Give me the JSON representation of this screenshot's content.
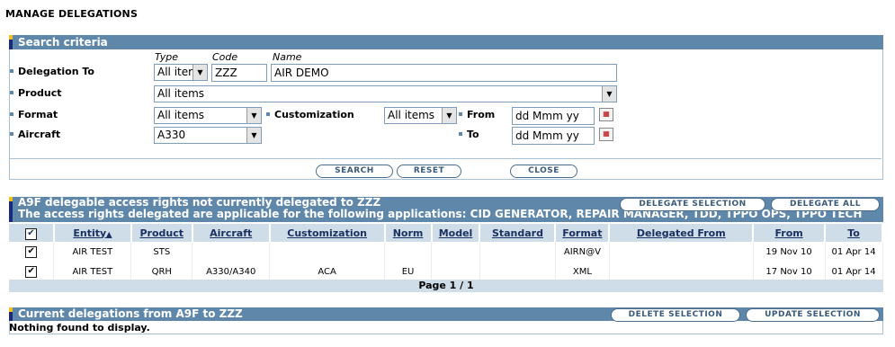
{
  "page_title": "MANAGE DELEGATIONS",
  "search": {
    "header": "Search criteria",
    "col_type": "Type",
    "col_code": "Code",
    "col_name": "Name",
    "delegation_to_label": "Delegation To",
    "delegation_type_value": "All iter",
    "delegation_code_value": "ZZZ",
    "delegation_name_value": "AIR DEMO",
    "product_label": "Product",
    "product_value": "All items",
    "format_label": "Format",
    "format_value": "All items",
    "customization_label": "Customization",
    "customization_value": "All items",
    "from_label": "From",
    "from_placeholder": "dd Mmm yy",
    "to_label": "To",
    "to_placeholder": "dd Mmm yy",
    "aircraft_label": "Aircraft",
    "aircraft_value": "A330",
    "search_button": "SEARCH",
    "reset_button": "RESET",
    "close_button": "CLOSE"
  },
  "rights": {
    "header_line1": "A9F delegable access rights not currently delegated to ZZZ",
    "header_line2": "The access rights delegated are applicable for the following applications: CID GENERATOR, REPAIR MANAGER, TDD, TPPO OPS, TPPO TECH",
    "delegate_selection_button": "DELEGATE SELECTION",
    "delegate_all_button": "DELEGATE ALL",
    "columns": [
      "Entity",
      "Product",
      "Aircraft",
      "Customization",
      "Norm",
      "Model",
      "Standard",
      "Format",
      "Delegated From",
      "From",
      "To"
    ],
    "sort_indicator": "▲",
    "rows": [
      {
        "entity": "AIR TEST",
        "product": "STS",
        "aircraft": "",
        "customization": "",
        "norm": "",
        "model": "",
        "standard": "",
        "format": "AIRN@V",
        "delegated_from": "",
        "from": "19 Nov 10",
        "to": "01 Apr 14"
      },
      {
        "entity": "AIR TEST",
        "product": "QRH",
        "aircraft": "A330/A340",
        "customization": "ACA",
        "norm": "EU",
        "model": "",
        "standard": "",
        "format": "XML",
        "delegated_from": "",
        "from": "17 Nov 10",
        "to": "01 Apr 14"
      }
    ],
    "pager": "Page 1 / 1"
  },
  "current": {
    "header": "Current delegations from A9F to ZZZ",
    "delete_selection_button": "DELETE SELECTION",
    "update_selection_button": "UPDATE SELECTION",
    "empty_text": "Nothing found to display."
  },
  "colors": {
    "bar": "#5f87aa",
    "table_header": "#cfdde9",
    "accent_dark": "#1a2a78",
    "accent_yellow": "#f0c020"
  }
}
